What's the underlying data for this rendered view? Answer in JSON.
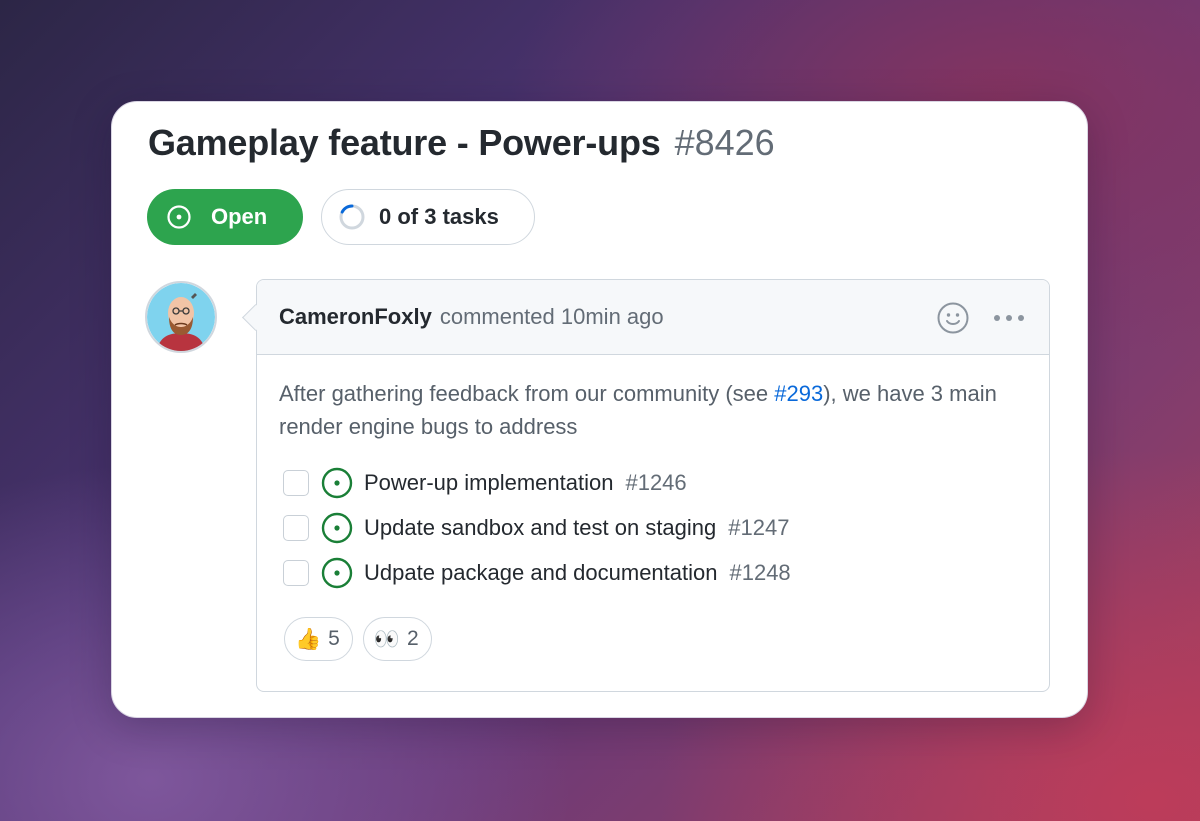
{
  "issue": {
    "title": "Gameplay feature - Power-ups",
    "number": "#8426",
    "state": "Open",
    "tasks_progress": "0 of 3 tasks",
    "tasks_completed_fraction": 0
  },
  "comment": {
    "author": "CameronFoxly",
    "meta": "commented 10min ago",
    "body_before_link": "After gathering feedback from our community (see ",
    "body_link": "#293",
    "body_after_link": "), we have 3 main render engine bugs to address",
    "tasks": [
      {
        "title": "Power-up implementation",
        "number": "#1246",
        "checked": false
      },
      {
        "title": "Update sandbox and test on staging",
        "number": "#1247",
        "checked": false
      },
      {
        "title": "Udpate package and documentation",
        "number": "#1248",
        "checked": false
      }
    ],
    "reactions": [
      {
        "icon": "thumbs-up-icon",
        "emoji": "👍",
        "count": "5"
      },
      {
        "icon": "eyes-icon",
        "emoji": "👀",
        "count": "2"
      }
    ],
    "header_icons": [
      "smiley-icon",
      "kebab-menu-icon"
    ]
  },
  "colors": {
    "open_green": "#2da44e",
    "link_blue": "#0969da",
    "issue_icon_green": "#1a7f37"
  }
}
